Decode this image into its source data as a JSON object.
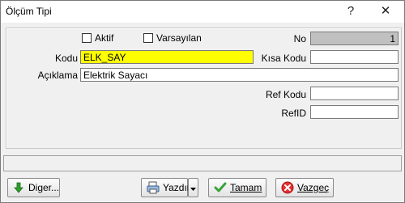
{
  "window": {
    "title": "Ölçüm Tipi",
    "help_glyph": "?",
    "close_glyph": "✕"
  },
  "form": {
    "aktif_label": "Aktif",
    "varsayilan_label": "Varsayılan",
    "no_label": "No",
    "no_value": "1",
    "kodu_label": "Kodu",
    "kodu_value": "ELK_SAY",
    "kisa_kodu_label": "Kısa Kodu",
    "kisa_kodu_value": "",
    "aciklama_label": "Açıklama",
    "aciklama_value": "Elektrik Sayacı",
    "ref_kodu_label": "Ref Kodu",
    "ref_kodu_value": "",
    "refid_label": "RefID",
    "refid_value": ""
  },
  "buttons": {
    "diger_label": "Diger...",
    "yazdir_label": "Yazdır",
    "tamam_label": "Tamam",
    "vazgec_label": "Vazgeç"
  },
  "colors": {
    "kodu_bg": "#ffff00",
    "no_bg": "#c0c0c0"
  },
  "icons": [
    "help-icon",
    "close-icon",
    "down-arrow-icon",
    "print-icon",
    "dropdown-arrow-icon",
    "check-icon",
    "cancel-icon"
  ]
}
